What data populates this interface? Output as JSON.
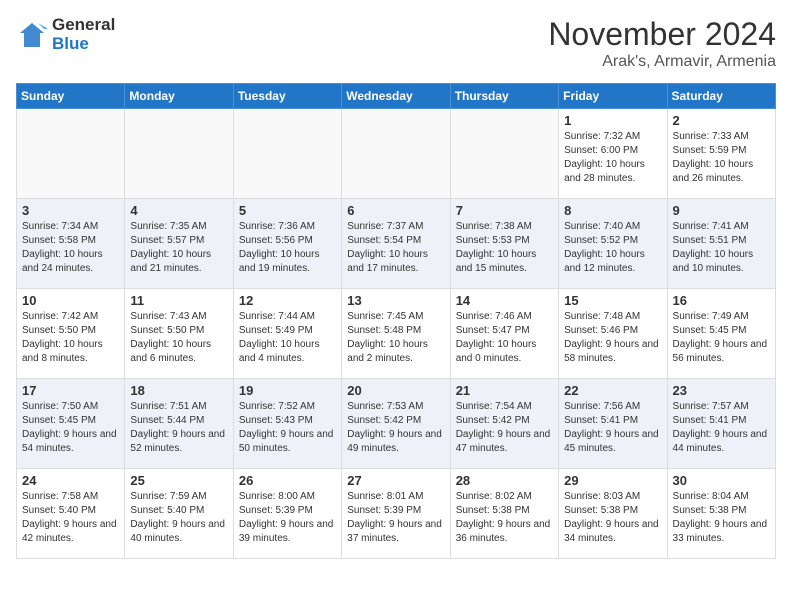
{
  "logo": {
    "general": "General",
    "blue": "Blue"
  },
  "title": {
    "month": "November 2024",
    "location": "Arak's, Armavir, Armenia"
  },
  "weekdays": [
    "Sunday",
    "Monday",
    "Tuesday",
    "Wednesday",
    "Thursday",
    "Friday",
    "Saturday"
  ],
  "weeks": [
    [
      {
        "day": null
      },
      {
        "day": null
      },
      {
        "day": null
      },
      {
        "day": null
      },
      {
        "day": null
      },
      {
        "day": "1",
        "sunrise": "7:32 AM",
        "sunset": "6:00 PM",
        "daylight": "10 hours and 28 minutes."
      },
      {
        "day": "2",
        "sunrise": "7:33 AM",
        "sunset": "5:59 PM",
        "daylight": "10 hours and 26 minutes."
      }
    ],
    [
      {
        "day": "3",
        "sunrise": "7:34 AM",
        "sunset": "5:58 PM",
        "daylight": "10 hours and 24 minutes."
      },
      {
        "day": "4",
        "sunrise": "7:35 AM",
        "sunset": "5:57 PM",
        "daylight": "10 hours and 21 minutes."
      },
      {
        "day": "5",
        "sunrise": "7:36 AM",
        "sunset": "5:56 PM",
        "daylight": "10 hours and 19 minutes."
      },
      {
        "day": "6",
        "sunrise": "7:37 AM",
        "sunset": "5:54 PM",
        "daylight": "10 hours and 17 minutes."
      },
      {
        "day": "7",
        "sunrise": "7:38 AM",
        "sunset": "5:53 PM",
        "daylight": "10 hours and 15 minutes."
      },
      {
        "day": "8",
        "sunrise": "7:40 AM",
        "sunset": "5:52 PM",
        "daylight": "10 hours and 12 minutes."
      },
      {
        "day": "9",
        "sunrise": "7:41 AM",
        "sunset": "5:51 PM",
        "daylight": "10 hours and 10 minutes."
      }
    ],
    [
      {
        "day": "10",
        "sunrise": "7:42 AM",
        "sunset": "5:50 PM",
        "daylight": "10 hours and 8 minutes."
      },
      {
        "day": "11",
        "sunrise": "7:43 AM",
        "sunset": "5:50 PM",
        "daylight": "10 hours and 6 minutes."
      },
      {
        "day": "12",
        "sunrise": "7:44 AM",
        "sunset": "5:49 PM",
        "daylight": "10 hours and 4 minutes."
      },
      {
        "day": "13",
        "sunrise": "7:45 AM",
        "sunset": "5:48 PM",
        "daylight": "10 hours and 2 minutes."
      },
      {
        "day": "14",
        "sunrise": "7:46 AM",
        "sunset": "5:47 PM",
        "daylight": "10 hours and 0 minutes."
      },
      {
        "day": "15",
        "sunrise": "7:48 AM",
        "sunset": "5:46 PM",
        "daylight": "9 hours and 58 minutes."
      },
      {
        "day": "16",
        "sunrise": "7:49 AM",
        "sunset": "5:45 PM",
        "daylight": "9 hours and 56 minutes."
      }
    ],
    [
      {
        "day": "17",
        "sunrise": "7:50 AM",
        "sunset": "5:45 PM",
        "daylight": "9 hours and 54 minutes."
      },
      {
        "day": "18",
        "sunrise": "7:51 AM",
        "sunset": "5:44 PM",
        "daylight": "9 hours and 52 minutes."
      },
      {
        "day": "19",
        "sunrise": "7:52 AM",
        "sunset": "5:43 PM",
        "daylight": "9 hours and 50 minutes."
      },
      {
        "day": "20",
        "sunrise": "7:53 AM",
        "sunset": "5:42 PM",
        "daylight": "9 hours and 49 minutes."
      },
      {
        "day": "21",
        "sunrise": "7:54 AM",
        "sunset": "5:42 PM",
        "daylight": "9 hours and 47 minutes."
      },
      {
        "day": "22",
        "sunrise": "7:56 AM",
        "sunset": "5:41 PM",
        "daylight": "9 hours and 45 minutes."
      },
      {
        "day": "23",
        "sunrise": "7:57 AM",
        "sunset": "5:41 PM",
        "daylight": "9 hours and 44 minutes."
      }
    ],
    [
      {
        "day": "24",
        "sunrise": "7:58 AM",
        "sunset": "5:40 PM",
        "daylight": "9 hours and 42 minutes."
      },
      {
        "day": "25",
        "sunrise": "7:59 AM",
        "sunset": "5:40 PM",
        "daylight": "9 hours and 40 minutes."
      },
      {
        "day": "26",
        "sunrise": "8:00 AM",
        "sunset": "5:39 PM",
        "daylight": "9 hours and 39 minutes."
      },
      {
        "day": "27",
        "sunrise": "8:01 AM",
        "sunset": "5:39 PM",
        "daylight": "9 hours and 37 minutes."
      },
      {
        "day": "28",
        "sunrise": "8:02 AM",
        "sunset": "5:38 PM",
        "daylight": "9 hours and 36 minutes."
      },
      {
        "day": "29",
        "sunrise": "8:03 AM",
        "sunset": "5:38 PM",
        "daylight": "9 hours and 34 minutes."
      },
      {
        "day": "30",
        "sunrise": "8:04 AM",
        "sunset": "5:38 PM",
        "daylight": "9 hours and 33 minutes."
      }
    ]
  ],
  "labels": {
    "sunrise": "Sunrise:",
    "sunset": "Sunset:",
    "daylight": "Daylight:"
  }
}
